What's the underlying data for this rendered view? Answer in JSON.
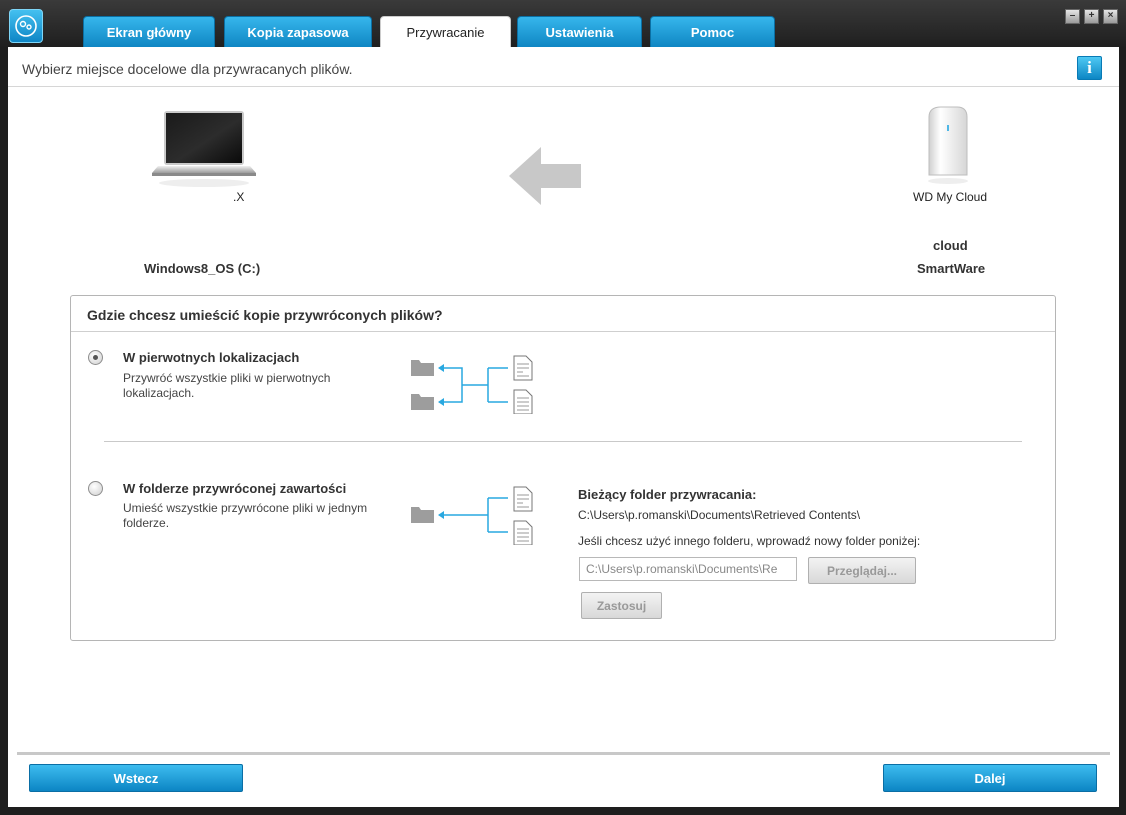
{
  "tabs": [
    {
      "label": "Ekran główny"
    },
    {
      "label": "Kopia zapasowa"
    },
    {
      "label": "Przywracanie"
    },
    {
      "label": "Ustawienia"
    },
    {
      "label": "Pomoc"
    }
  ],
  "active_tab": "Przywracanie",
  "header": {
    "instruction": "Wybierz miejsce docelowe dla przywracanych plików.",
    "info_icon": "i"
  },
  "source": {
    "device_label": ".X",
    "drive_name": "Windows8_OS (C:)"
  },
  "target": {
    "device_label": "WD My Cloud",
    "share_name": "cloud",
    "app_name": "SmartWare"
  },
  "question": {
    "title": "Gdzie chcesz umieścić kopie przywróconych plików?",
    "option_original": {
      "title": "W pierwotnych lokalizacjach",
      "description": "Przywróć wszystkie pliki w pierwotnych lokalizacjach.",
      "selected": true
    },
    "option_folder": {
      "title": "W folderze przywróconej zawartości",
      "description": "Umieść wszystkie przywrócone pliki w jednym folderze.",
      "selected": false
    },
    "current_folder_label": "Bieżący folder przywracania:",
    "current_folder_path": "C:\\Users\\p.romanski\\Documents\\Retrieved Contents\\",
    "other_folder_hint": "Jeśli chcesz użyć innego folderu, wprowadź nowy folder poniżej:",
    "folder_input_value": "C:\\Users\\p.romanski\\Documents\\Re",
    "browse_label": "Przeglądaj...",
    "apply_label": "Zastosuj"
  },
  "footer": {
    "back_label": "Wstecz",
    "next_label": "Dalej"
  },
  "colors": {
    "accent": "#1a9ad6",
    "arrow": "#c8c8c8",
    "diagram_line": "#29a8e0"
  }
}
